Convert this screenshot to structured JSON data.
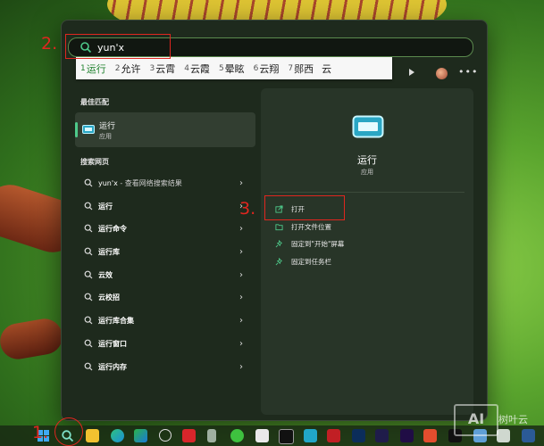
{
  "search": {
    "value": "yun'x"
  },
  "ime": {
    "candidates": [
      {
        "n": "1",
        "t": "运行"
      },
      {
        "n": "2",
        "t": "允许"
      },
      {
        "n": "3",
        "t": "云霄"
      },
      {
        "n": "4",
        "t": "云霞"
      },
      {
        "n": "5",
        "t": "晕眩"
      },
      {
        "n": "6",
        "t": "云翔"
      },
      {
        "n": "7",
        "t": "郧西"
      }
    ],
    "overflow": "云"
  },
  "left": {
    "best_match_header": "最佳匹配",
    "best_match": {
      "title": "运行",
      "subtitle": "应用"
    },
    "web_header": "搜索网页",
    "rows": [
      {
        "label": "yun'x",
        "suffix": " - 查看网络搜索结果"
      },
      {
        "label": "运行"
      },
      {
        "label": "运行命令"
      },
      {
        "label": "运行库"
      },
      {
        "label": "云效"
      },
      {
        "label": "云校招"
      },
      {
        "label": "运行库合集"
      },
      {
        "label": "运行窗口"
      },
      {
        "label": "运行内存"
      }
    ]
  },
  "right": {
    "title": "运行",
    "subtitle": "应用",
    "actions": [
      {
        "label": "打开",
        "icon": "open-icon"
      },
      {
        "label": "打开文件位置",
        "icon": "folder-icon"
      },
      {
        "label": "固定到\"开始\"屏幕",
        "icon": "pin-icon"
      },
      {
        "label": "固定到任务栏",
        "icon": "pin-icon"
      }
    ]
  },
  "annotations": {
    "one": "1.",
    "two": "2.",
    "three": "3."
  },
  "watermark": {
    "mark": "AI",
    "text": "树叶云"
  },
  "colors": {
    "accent": "#4ec98a",
    "annotation": "#e0261f",
    "panel": "#1e2a1d"
  }
}
